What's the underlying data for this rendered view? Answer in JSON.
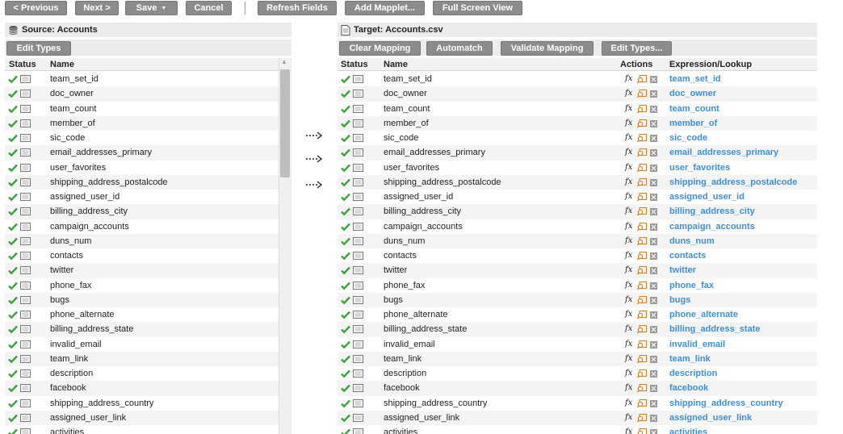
{
  "toolbar": {
    "previous": "< Previous",
    "next": "Next >",
    "save": "Save",
    "cancel": "Cancel",
    "refresh_fields": "Refresh Fields",
    "add_mapplet": "Add Mapplet...",
    "full_screen_view": "Full Screen View"
  },
  "source": {
    "title": "Source: Accounts",
    "edit_types": "Edit Types",
    "columns": {
      "status": "Status",
      "name": "Name"
    },
    "rows": [
      "team_set_id",
      "doc_owner",
      "team_count",
      "member_of",
      "sic_code",
      "email_addresses_primary",
      "user_favorites",
      "shipping_address_postalcode",
      "assigned_user_id",
      "billing_address_city",
      "campaign_accounts",
      "duns_num",
      "contacts",
      "twitter",
      "phone_fax",
      "bugs",
      "phone_alternate",
      "billing_address_state",
      "invalid_email",
      "team_link",
      "description",
      "facebook",
      "shipping_address_country",
      "assigned_user_link",
      "activities"
    ]
  },
  "target": {
    "title": "Target: Accounts.csv",
    "clear_mapping": "Clear Mapping",
    "automatch": "Automatch",
    "validate_mapping": "Validate Mapping",
    "edit_types": "Edit Types...",
    "columns": {
      "status": "Status",
      "name": "Name",
      "actions": "Actions",
      "expression": "Expression/Lookup"
    },
    "fx_label": "fx",
    "rows": [
      "team_set_id",
      "doc_owner",
      "team_count",
      "member_of",
      "sic_code",
      "email_addresses_primary",
      "user_favorites",
      "shipping_address_postalcode",
      "assigned_user_id",
      "billing_address_city",
      "campaign_accounts",
      "duns_num",
      "contacts",
      "twitter",
      "phone_fax",
      "bugs",
      "phone_alternate",
      "billing_address_state",
      "invalid_email",
      "team_link",
      "description",
      "facebook",
      "shipping_address_country",
      "assigned_user_link",
      "activities"
    ],
    "expressions": [
      "team_set_id",
      "doc_owner",
      "team_count",
      "member_of",
      "sic_code",
      "email_addresses_primary",
      "user_favorites",
      "shipping_address_postalcode",
      "assigned_user_id",
      "billing_address_city",
      "campaign_accounts",
      "duns_num",
      "contacts",
      "twitter",
      "phone_fax",
      "bugs",
      "phone_alternate",
      "billing_address_state",
      "invalid_email",
      "team_link",
      "description",
      "facebook",
      "shipping_address_country",
      "assigned_user_link",
      "activities"
    ]
  },
  "colors": {
    "button": "#8c8c8c",
    "check": "#3aa33a",
    "link": "#3d8fd9",
    "lookup_icon": "#e07a1a"
  }
}
